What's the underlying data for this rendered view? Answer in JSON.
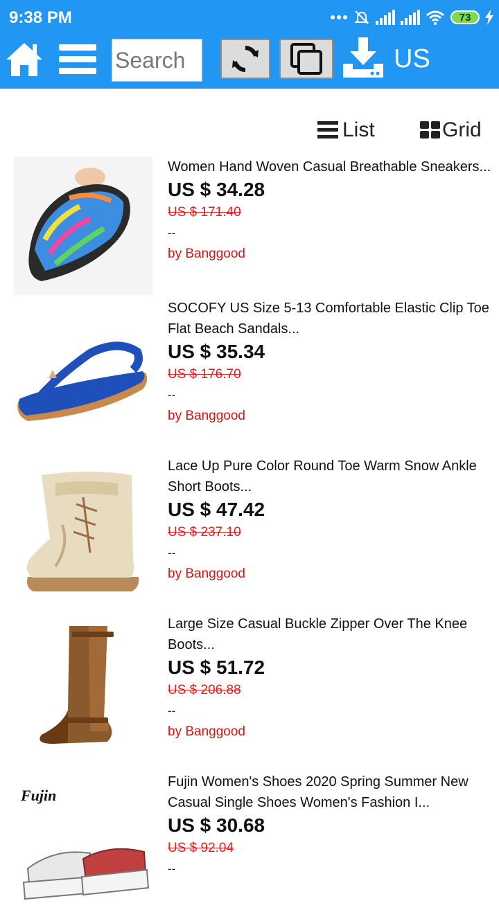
{
  "status_bar": {
    "time": "9:38 PM",
    "battery": "73"
  },
  "toolbar": {
    "search_placeholder": "Search",
    "region_label": "US"
  },
  "view_toggle": {
    "list_label": "List",
    "grid_label": "Grid"
  },
  "products": [
    {
      "title": "Women Hand Woven Casual Breathable Sneakers...",
      "price": "US $ 34.28",
      "old_price": "US $ 171.40",
      "extra": "--",
      "seller": "by Banggood",
      "image": "woven-sneaker-image"
    },
    {
      "title": "SOCOFY US Size 5-13 Comfortable Elastic Clip Toe Flat Beach Sandals...",
      "price": "US $ 35.34",
      "old_price": "US $ 176.70",
      "extra": "--",
      "seller": "by Banggood",
      "image": "blue-sandal-image"
    },
    {
      "title": "Lace Up Pure Color Round Toe Warm Snow Ankle Short Boots...",
      "price": "US $ 47.42",
      "old_price": "US $ 237.10",
      "extra": "--",
      "seller": "by Banggood",
      "image": "beige-boot-image"
    },
    {
      "title": "Large Size Casual Buckle Zipper Over The Knee Boots...",
      "price": "US $ 51.72",
      "old_price": "US $ 206.88",
      "extra": "--",
      "seller": "by Banggood",
      "image": "knee-boot-image"
    },
    {
      "title": "Fujin Women's Shoes 2020 Spring Summer New Casual Single Shoes Women's Fashion I...",
      "price": "US $ 30.68",
      "old_price": "US $ 92.04",
      "extra": "--",
      "seller": "",
      "image": "platform-shoe-image",
      "brand_logo": "Fujin"
    }
  ],
  "colors": {
    "header": "#2196f3",
    "seller": "#d01818",
    "old_price": "#e02020"
  }
}
